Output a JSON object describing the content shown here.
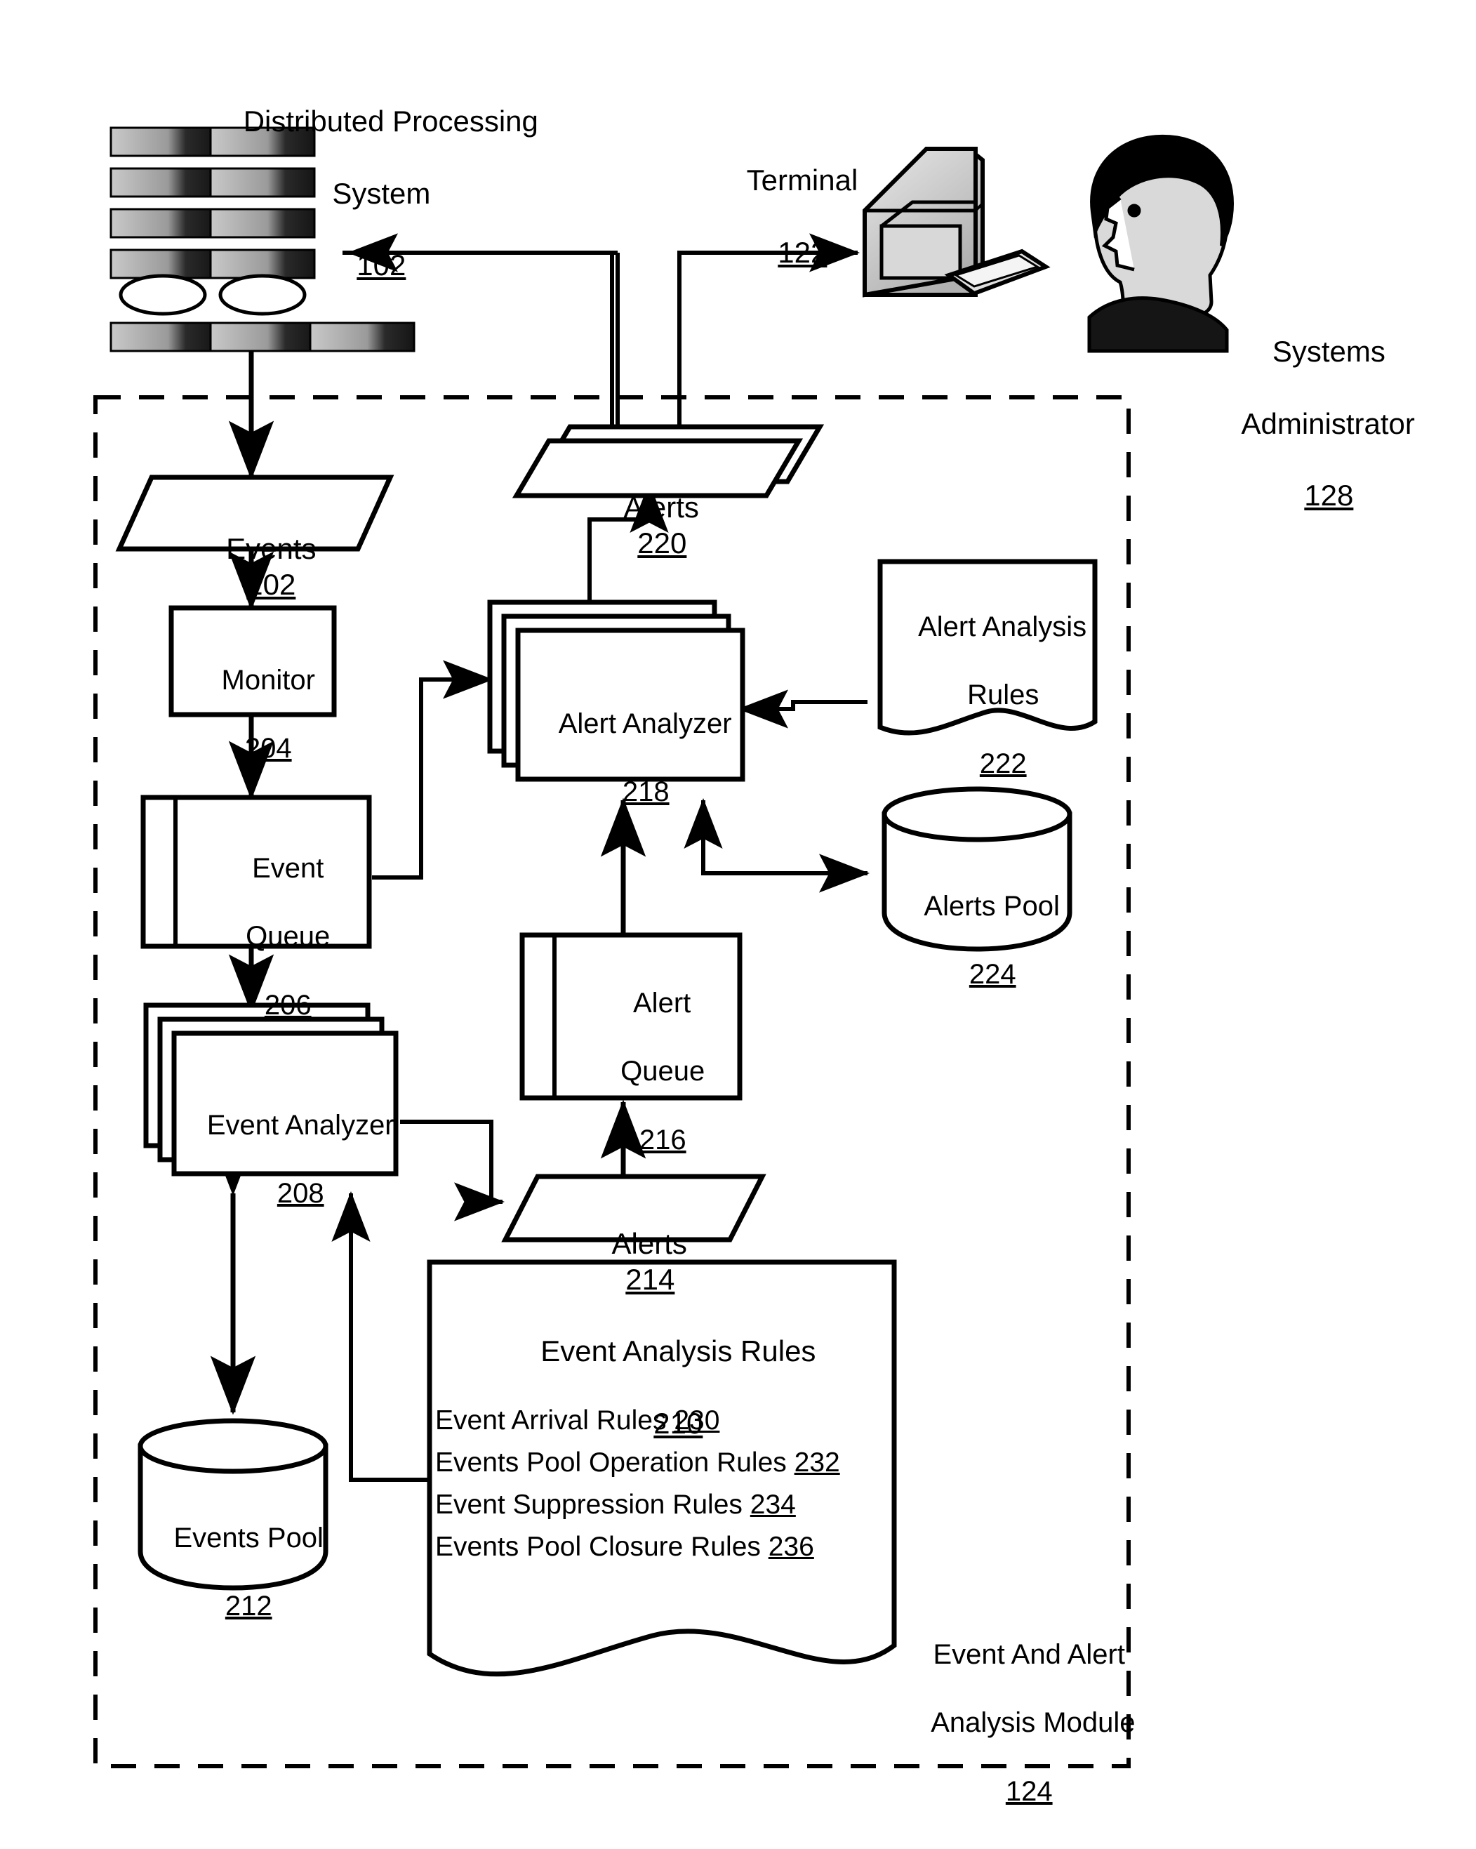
{
  "figure": {
    "title_none": "",
    "top_left_system": {
      "name": "Distributed Processing",
      "name2": "System",
      "ref": "102"
    },
    "terminal": {
      "name": "Terminal",
      "ref": "122"
    },
    "admin": {
      "name1": "Systems",
      "name2": "Administrator",
      "ref": "128"
    },
    "module": {
      "name1": "Event And Alert",
      "name2": "Analysis Module",
      "ref": "124"
    }
  },
  "nodes": {
    "events_202": {
      "label": "Events",
      "ref": "202",
      "shape": "parallelogram"
    },
    "alerts_220": {
      "label": "Alerts",
      "ref": "220",
      "shape": "parallelogram-stack"
    },
    "monitor_204": {
      "label": "Monitor",
      "ref": "204",
      "shape": "rect"
    },
    "event_queue_206": {
      "line1": "Event",
      "line2": "Queue",
      "ref": "206",
      "shape": "queue"
    },
    "event_analyzer_208": {
      "label": "Event Analyzer",
      "ref": "208",
      "shape": "rect-stack"
    },
    "events_pool_212": {
      "label": "Events Pool",
      "ref": "212",
      "shape": "cylinder"
    },
    "alerts_214": {
      "label": "Alerts",
      "ref": "214",
      "shape": "parallelogram"
    },
    "alert_queue_216": {
      "line1": "Alert",
      "line2": "Queue",
      "ref": "216",
      "shape": "queue"
    },
    "alert_analyzer_218": {
      "label": "Alert Analyzer",
      "ref": "218",
      "shape": "rect-stack"
    },
    "alert_rules_222": {
      "line1": "Alert Analysis",
      "line2": "Rules",
      "ref": "222",
      "shape": "document"
    },
    "alerts_pool_224": {
      "label": "Alerts Pool",
      "ref": "224",
      "shape": "cylinder"
    },
    "event_rules_210": {
      "label": "Event Analysis Rules",
      "ref": "210",
      "shape": "document"
    }
  },
  "event_rules_items": [
    {
      "label": "Event Arrival Rules",
      "ref": "230"
    },
    {
      "label": "Events Pool Operation Rules",
      "ref": "232"
    },
    {
      "label": "Event Suppression Rules",
      "ref": "234"
    },
    {
      "label": "Events Pool Closure Rules",
      "ref": "236"
    }
  ],
  "colors": {
    "line": "#000000",
    "fill": "#ffffff",
    "page": "#ffffff"
  }
}
